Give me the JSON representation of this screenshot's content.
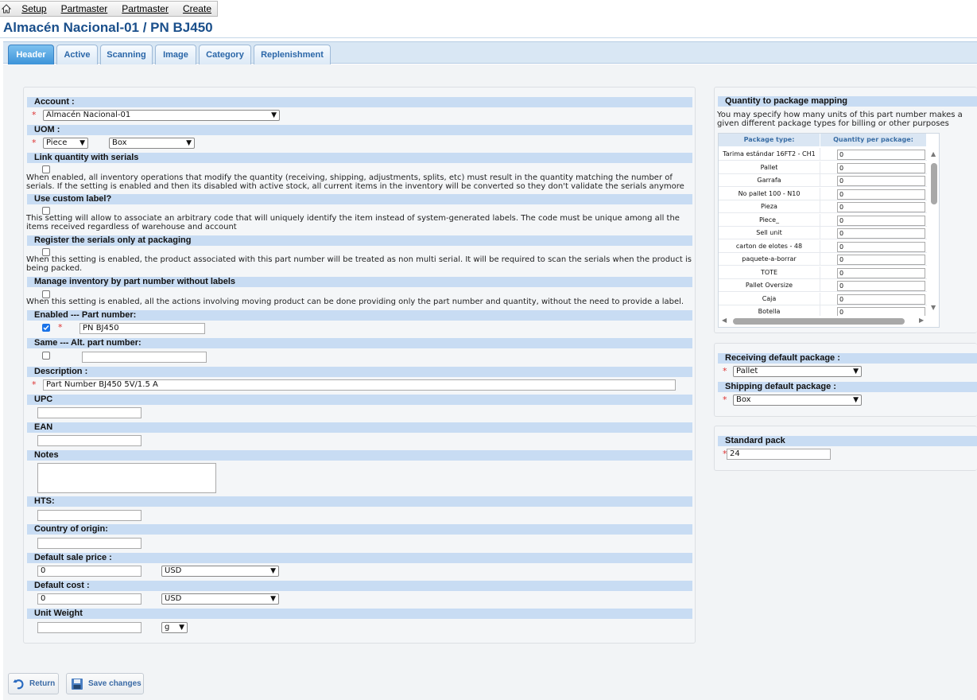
{
  "breadcrumb": {
    "items": [
      "Setup",
      "Partmaster",
      "Partmaster",
      "Create"
    ]
  },
  "page_title": "Almacén Nacional-01 / PN BJ450",
  "tabs": [
    "Header",
    "Active",
    "Scanning",
    "Image",
    "Category",
    "Replenishment"
  ],
  "active_tab": "Header",
  "form": {
    "account": {
      "label": "Account :",
      "value": "Almacén Nacional-01"
    },
    "uom": {
      "label": "UOM :",
      "value1": "Piece",
      "value2": "Box"
    },
    "link_serials": {
      "label": "Link quantity with serials",
      "desc": "When enabled, all inventory operations that modify the quantity (receiving, shipping, adjustments, splits, etc) must result in the quantity matching the number of serials. If the setting is enabled and then its disabled with active stock, all current items in the inventory will be converted so they don't validate the serials anymore"
    },
    "custom_label": {
      "label": "Use custom label?",
      "desc": "This setting will allow to associate an arbitrary code that will uniquely identify the item instead of system-generated labels. The code must be unique among all the items received regardless of warehouse and account"
    },
    "serials_packaging": {
      "label": "Register the serials only at packaging",
      "desc": "When this setting is enabled, the product associated with this part number will be treated as non multi serial. It will be required to scan the serials when the product is being packed."
    },
    "manage_no_labels": {
      "label": "Manage inventory by part number without labels",
      "desc": "When this setting is enabled, all the actions involving moving product can be done providing only the part number and quantity, without the need to provide a label."
    },
    "part_number": {
      "label": "Enabled --- Part number:",
      "value": "PN BJ450",
      "enabled": true
    },
    "alt_part_number": {
      "label": "Same --- Alt. part number:",
      "value": "",
      "same": false
    },
    "description": {
      "label": "Description :",
      "value": "Part Number BJ450 5V/1.5 A"
    },
    "upc": {
      "label": "UPC",
      "value": ""
    },
    "ean": {
      "label": "EAN",
      "value": ""
    },
    "notes": {
      "label": "Notes",
      "value": ""
    },
    "hts": {
      "label": "HTS:",
      "value": ""
    },
    "country": {
      "label": "Country of origin:",
      "value": ""
    },
    "sale_price": {
      "label": "Default sale price :",
      "value": "0",
      "currency": "USD"
    },
    "cost": {
      "label": "Default cost :",
      "value": "0",
      "currency": "USD"
    },
    "unit_weight": {
      "label": "Unit Weight",
      "value": "",
      "unit": "g"
    }
  },
  "mapping": {
    "title": "Quantity to package mapping",
    "desc": "You may specify how many units of this part number makes a given different package types for billing or other purposes",
    "col_type": "Package type:",
    "col_qty": "Quantity per package:",
    "rows": [
      {
        "type": "Tarima estándar 16FT2 - CH1",
        "qty": "0"
      },
      {
        "type": "Pallet",
        "qty": "0"
      },
      {
        "type": "Garrafa",
        "qty": "0"
      },
      {
        "type": "No pallet 100 - N10",
        "qty": "0"
      },
      {
        "type": "Pieza",
        "qty": "0"
      },
      {
        "type": "Piece_",
        "qty": "0"
      },
      {
        "type": "Sell unit",
        "qty": "0"
      },
      {
        "type": "carton de elotes - 48",
        "qty": "0"
      },
      {
        "type": "paquete-a-borrar",
        "qty": "0"
      },
      {
        "type": "TOTE",
        "qty": "0"
      },
      {
        "type": "Pallet Oversize",
        "qty": "0"
      },
      {
        "type": "Caja",
        "qty": "0"
      },
      {
        "type": "Botella",
        "qty": "0"
      }
    ]
  },
  "packages": {
    "receiving_label": "Receiving default package :",
    "receiving_value": "Pallet",
    "shipping_label": "Shipping default package :",
    "shipping_value": "Box"
  },
  "standard_pack": {
    "label": "Standard pack",
    "value": "24"
  },
  "buttons": {
    "return": "Return",
    "save": "Save changes"
  },
  "required_mark": "*"
}
